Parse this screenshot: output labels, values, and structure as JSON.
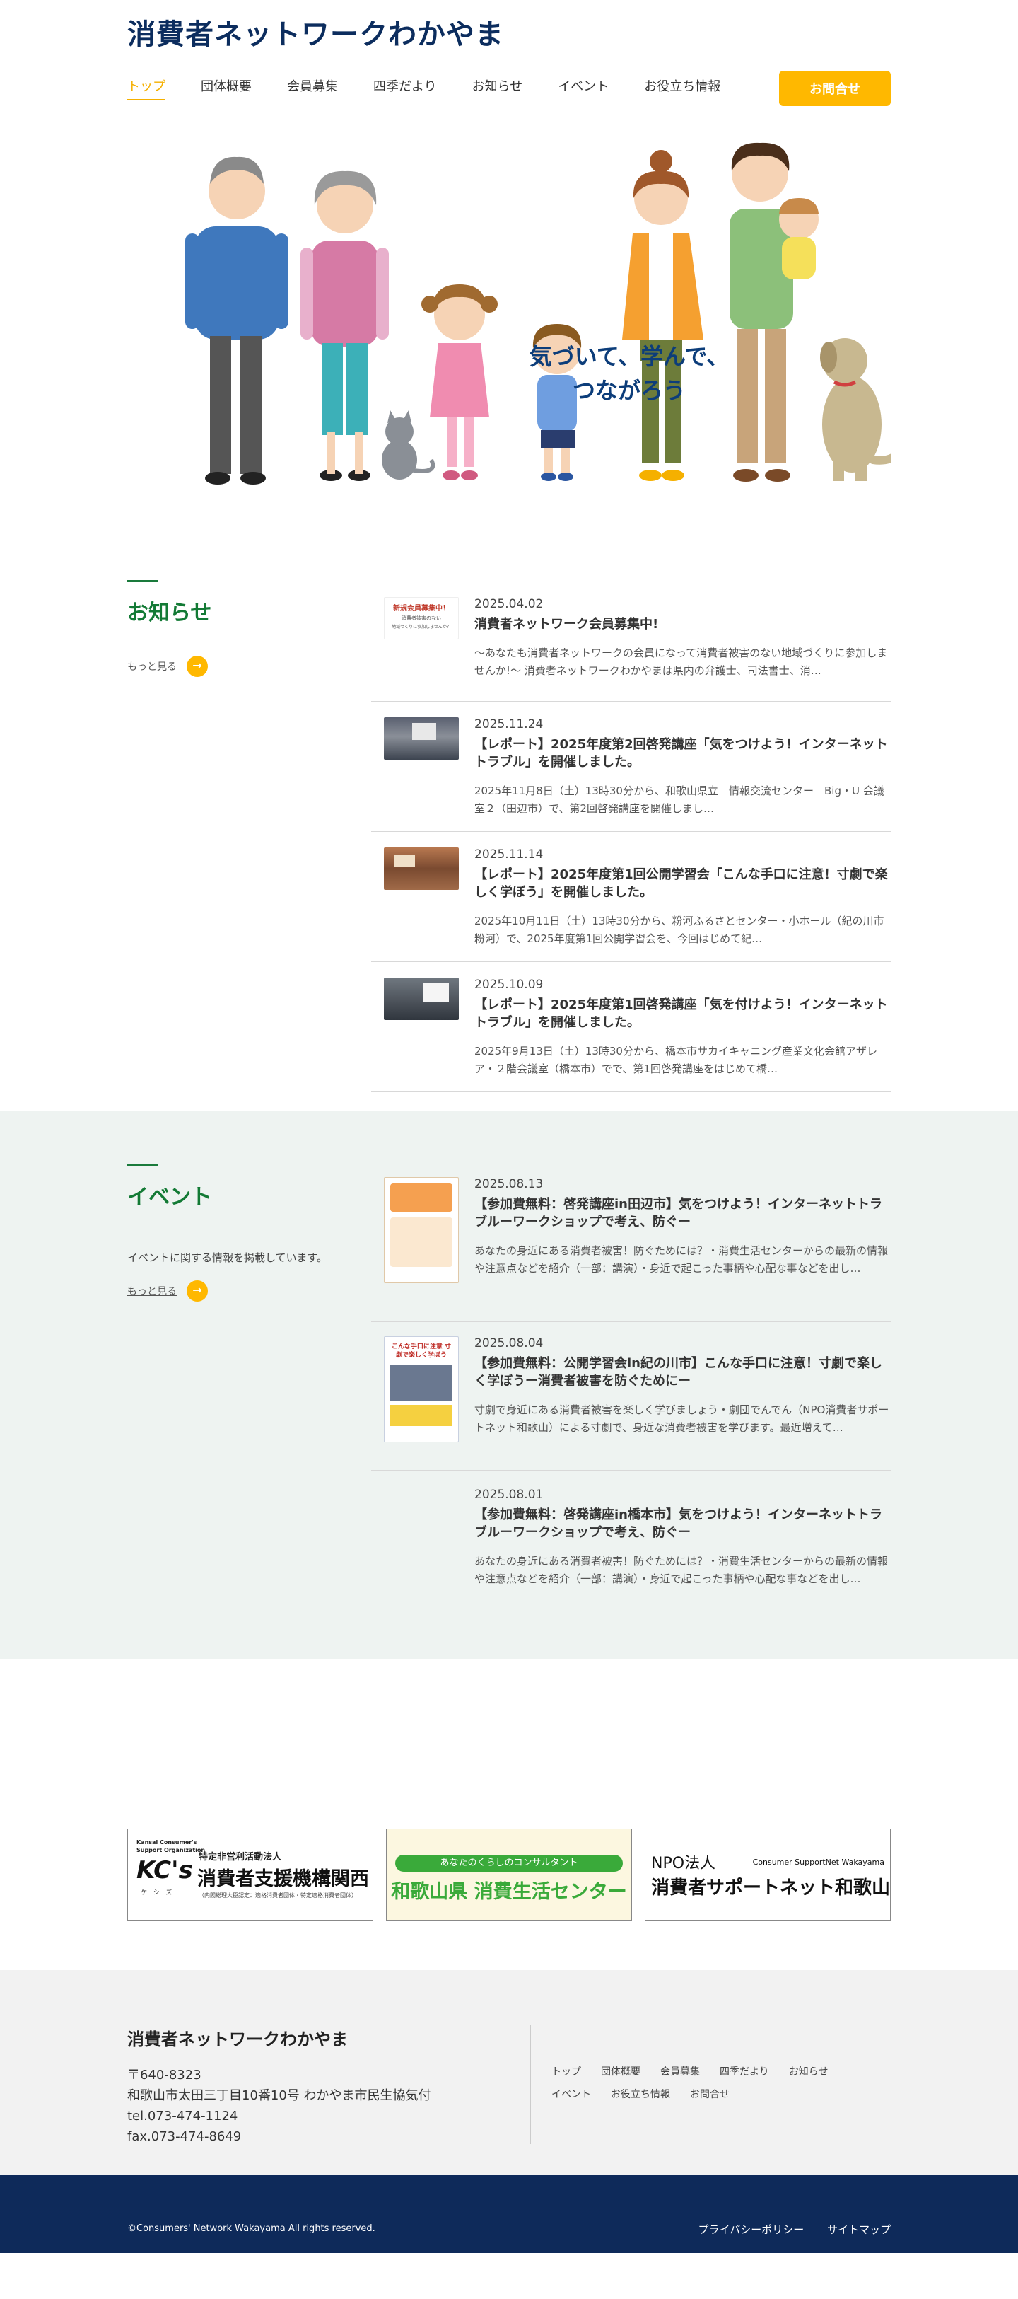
{
  "site": {
    "title": "消費者ネットワークわかやま"
  },
  "nav": {
    "items": [
      "トップ",
      "団体概要",
      "会員募集",
      "四季だより",
      "お知らせ",
      "イベント",
      "お役立ち情報"
    ],
    "contact_label": "お問合せ",
    "accent": "#ffb800"
  },
  "hero": {
    "copy_line1": "気づいて、学んで、",
    "copy_line2": "つながろう"
  },
  "news": {
    "title": "お知らせ",
    "more_label": "もっと見る",
    "items": [
      {
        "date": "2025.04.02",
        "title": "消費者ネットワーク会員募集中!",
        "excerpt": "～あなたも消費者ネットワークの会員になって消費者被害のない地域づくりに参加しませんか!～ 消費者ネットワークわかやまは県内の弁護士、司法書士、消…",
        "thumb_line1": "新規会員募集中！",
        "thumb_line2": "消費者被害のない",
        "thumb_line3": "地域づくりに参加しませんか？"
      },
      {
        "date": "2025.11.24",
        "title": "【レポート】2025年度第2回啓発講座「気をつけよう！インターネットトラブル」を開催しました。",
        "excerpt": "2025年11月8日（土）13時30分から、和歌山県立　情報交流センター　Big・U 会議室２（田辺市）で、第2回啓発講座を開催しまし…"
      },
      {
        "date": "2025.11.14",
        "title": "【レポート】2025年度第1回公開学習会「こんな手口に注意！寸劇で楽しく学ぼう」を開催しました。",
        "excerpt": "2025年10月11日（土）13時30分から、粉河ふるさとセンター・小ホール（紀の川市粉河）で、2025年度第1回公開学習会を、今回はじめて紀…"
      },
      {
        "date": "2025.10.09",
        "title": "【レポート】2025年度第1回啓発講座「気を付けよう！インターネットトラブル」を開催しました。",
        "excerpt": "2025年9月13日（土）13時30分から、橋本市サカイキャニング産業文化会館アザレア・２階会議室（橋本市）でで、第1回啓発講座をはじめて橋…"
      }
    ]
  },
  "events": {
    "title": "イベント",
    "description": "イベントに関する情報を掲載しています。",
    "more_label": "もっと見る",
    "items": [
      {
        "date": "2025.08.13",
        "title": "【参加費無料：啓発講座in田辺市】気をつけよう！インターネットトラブルーワークショップで考え、防ぐー",
        "excerpt": "あなたの身近にある消費者被害！防ぐためには？・消費生活センターからの最新の情報や注意点などを紹介（一部：講演）・身近で起こった事柄や心配な事などを出し…"
      },
      {
        "date": "2025.08.04",
        "title": "【参加費無料：公開学習会in紀の川市】こんな手口に注意！寸劇で楽しく学ぼうー消費者被害を防ぐためにー",
        "excerpt": "寸劇で身近にある消費者被害を楽しく学びましょう・劇団でんでん（NPO消費者サポートネット和歌山）による寸劇で、身近な消費者被害を学びます。最近増えて…",
        "thumb_text": "こんな手口に注意 寸劇で楽しく学ぼう"
      },
      {
        "date": "2025.08.01",
        "title": "【参加費無料：啓発講座in橋本市】気をつけよう！インターネットトラブルーワークショップで考え、防ぐー",
        "excerpt": "あなたの身近にある消費者被害！防ぐためには？・消費生活センターからの最新の情報や注意点などを紹介（一部：講演）・身近で起こった事柄や心配な事などを出し…"
      }
    ]
  },
  "banners": {
    "kcs": {
      "org_en_line1": "Kansai Consumer's",
      "org_en_line2": "Support Organization",
      "logo": "KC's",
      "logo_sub": "ケーシーズ",
      "type": "特定非営利活動法人",
      "name": "消費者支援機構関西",
      "note": "（内閣総理大臣認定：適格消費者団体・特定適格消費者団体）"
    },
    "center": {
      "tagline": "あなたのくらしのコンサルタント",
      "name": "和歌山県 消費生活センター"
    },
    "support": {
      "type": "NPO法人",
      "name_en": "Consumer SupportNet Wakayama",
      "name": "消費者サポートネット和歌山"
    }
  },
  "footer": {
    "name": "消費者ネットワークわかやま",
    "postal": "〒640-8323",
    "address": "和歌山市太田三丁目10番10号 わかやま市民生協気付",
    "tel": "tel.073-474-1124",
    "fax": "fax.073-474-8649",
    "nav": [
      "トップ",
      "団体概要",
      "会員募集",
      "四季だより",
      "お知らせ",
      "イベント",
      "お役立ち情報",
      "お問合せ"
    ],
    "copyright": "©Consumers' Network Wakayama All rights reserved.",
    "privacy": "プライバシーポリシー",
    "sitemap": "サイトマップ"
  }
}
